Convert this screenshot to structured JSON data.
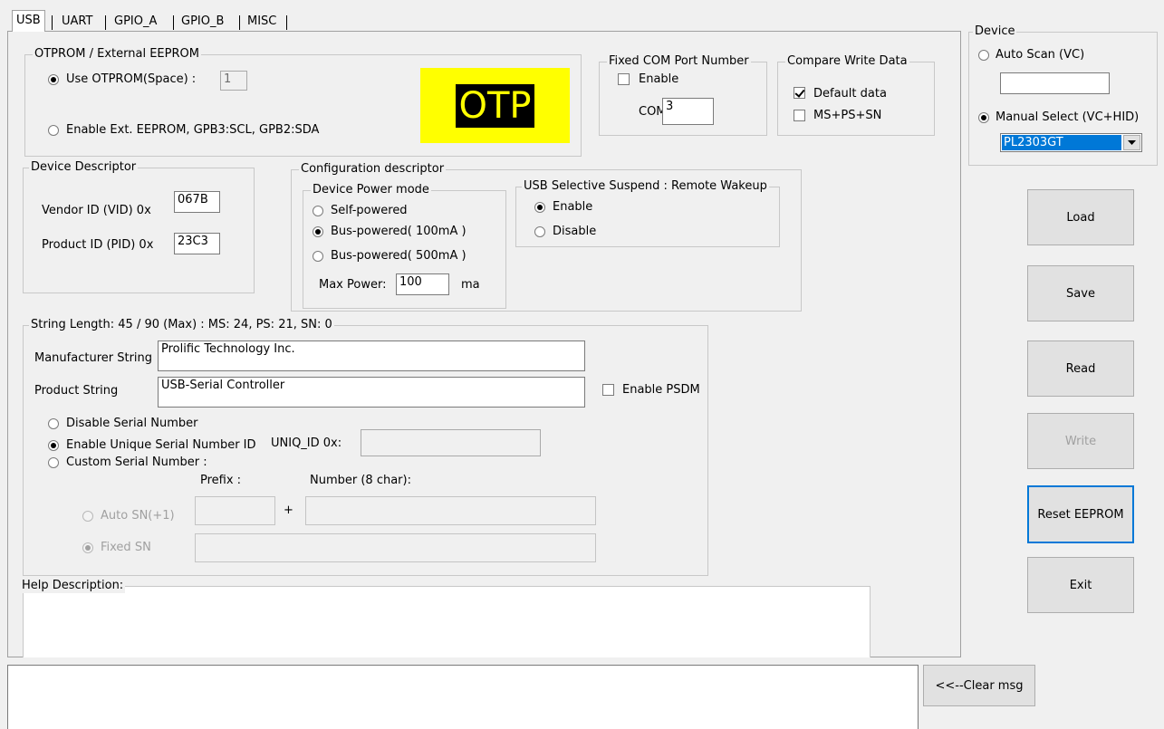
{
  "tabs": [
    "USB",
    "UART",
    "GPIO_A",
    "GPIO_B",
    "MISC"
  ],
  "otprom": {
    "legend": "OTPROM / External EEPROM",
    "use_otprom_label": "Use OTPROM(Space) :",
    "otprom_value": "1",
    "ext_eeprom_label": "Enable Ext. EEPROM, GPB3:SCL, GPB2:SDA",
    "badge_text": "OTP",
    "badge_bg": "#ffff00",
    "badge_fg": "#ffff00"
  },
  "fixed_com": {
    "legend": "Fixed COM Port Number",
    "enable_label": "Enable",
    "com_label": "COM",
    "com_value": "3"
  },
  "compare": {
    "legend": "Compare Write Data",
    "default_label": "Default data",
    "ms_label": "MS+PS+SN"
  },
  "device_descriptor": {
    "legend": "Device Descriptor",
    "vid_label": "Vendor ID (VID)  0x",
    "vid_value": "067B",
    "pid_label": "Product ID (PID)  0x",
    "pid_value": "23C3"
  },
  "config": {
    "legend": "Configuration descriptor",
    "power_legend": "Device Power mode",
    "self_label": "Self-powered",
    "bus100_label": "Bus-powered( 100mA )",
    "bus500_label": "Bus-powered( 500mA )",
    "max_power_label": "Max Power:",
    "max_power_value": "100",
    "max_power_unit": "ma"
  },
  "suspend": {
    "legend": "USB Selective Suspend : Remote Wakeup",
    "enable_label": "Enable",
    "disable_label": "Disable"
  },
  "strings": {
    "legend": "String Length: 45 / 90 (Max) :  MS: 24, PS: 21, SN: 0",
    "manufacturer_label": "Manufacturer String",
    "manufacturer_value": "Prolific Technology Inc.",
    "product_label": "Product String",
    "product_value": "USB-Serial Controller",
    "psdm_label": "Enable PSDM",
    "disable_sn_label": "Disable Serial Number",
    "unique_sn_label": "Enable Unique Serial Number ID",
    "uniq_id_label": "UNIQ_ID 0x:",
    "uniq_id_value": "",
    "custom_sn_label": "Custom Serial Number :",
    "prefix_label": "Prefix   :",
    "number_label": "Number (8 char):",
    "auto_sn_label": "Auto SN(+1)",
    "plus": "+",
    "fixed_sn_label": "Fixed SN"
  },
  "help": {
    "label": "Help Description:"
  },
  "device": {
    "legend": "Device",
    "auto_scan_label": "Auto Scan  (VC)",
    "auto_scan_value": "",
    "manual_label": "Manual Select  (VC+HID)",
    "selected": "PL2303GT",
    "select_color": "#0078d7"
  },
  "buttons": {
    "load": "Load",
    "save": "Save",
    "read": "Read",
    "write": "Write",
    "reset": "Reset EEPROM",
    "exit": "Exit",
    "clear": "<<--Clear msg"
  },
  "message_log": ""
}
